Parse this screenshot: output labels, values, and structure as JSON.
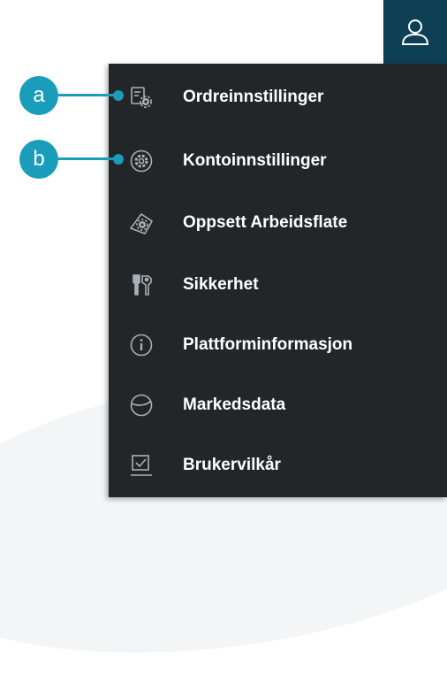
{
  "header": {
    "user_button_icon": "user-icon",
    "accent_color": "#0d3f55"
  },
  "callouts": [
    {
      "letter": "a",
      "target": "Ordreinnstillinger"
    },
    {
      "letter": "b",
      "target": "Kontoinnstillinger"
    }
  ],
  "menu": {
    "items": [
      {
        "label": "Ordreinnstillinger",
        "icon": "order-settings-icon"
      },
      {
        "label": "Kontoinnstillinger",
        "icon": "gear-icon"
      },
      {
        "label": "Oppsett Arbeidsflate",
        "icon": "workspace-setup-icon"
      },
      {
        "label": "Sikkerhet",
        "icon": "keys-icon"
      },
      {
        "label": "Plattforminformasjon",
        "icon": "info-icon"
      },
      {
        "label": "Markedsdata",
        "icon": "globe-icon"
      },
      {
        "label": "Brukervilkår",
        "icon": "terms-checkbox-icon"
      }
    ]
  },
  "colors": {
    "menu_background": "#222629",
    "callout": "#1a9dbb",
    "icon": "#a9b0b5"
  }
}
